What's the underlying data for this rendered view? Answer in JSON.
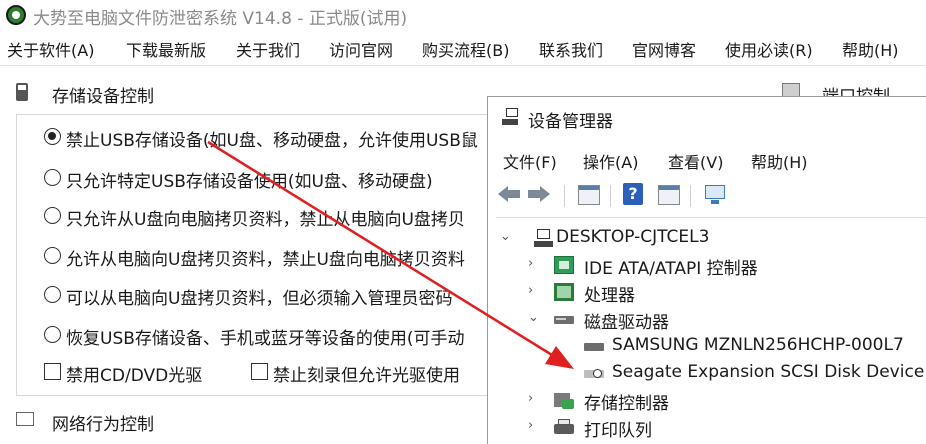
{
  "window": {
    "title": "大势至电脑文件防泄密系统 V14.8 - 正式版(试用)"
  },
  "menu": [
    "关于软件(A)",
    "下载最新版",
    "关于我们",
    "访问官网",
    "购买流程(B)",
    "联系我们",
    "官网博客",
    "使用必读(R)",
    "帮助(H)"
  ],
  "storage": {
    "title": "存储设备控制",
    "options": [
      {
        "label": "禁止USB存储设备(如U盘、移动硬盘，允许使用USB鼠",
        "checked": true
      },
      {
        "label": "只允许特定USB存储设备使用(如U盘、移动硬盘)",
        "checked": false
      },
      {
        "label": "只允许从U盘向电脑拷贝资料，禁止从电脑向U盘拷贝",
        "checked": false
      },
      {
        "label": "允许从电脑向U盘拷贝资料，禁止U盘向电脑拷贝资料",
        "checked": false
      },
      {
        "label": "可以从电脑向U盘拷贝资料，但必须输入管理员密码",
        "checked": false
      },
      {
        "label": "恢复USB存储设备、手机或蓝牙等设备的使用(可手动",
        "checked": false
      }
    ],
    "checkboxes": [
      {
        "label": "禁用CD/DVD光驱",
        "checked": false
      },
      {
        "label": "禁止刻录但允许光驱使用",
        "checked": false
      }
    ]
  },
  "port_title": "端口控制",
  "network_title": "网络行为控制",
  "device_manager": {
    "title": "设备管理器",
    "menu": [
      "文件(F)",
      "操作(A)",
      "查看(V)",
      "帮助(H)"
    ],
    "tree": {
      "root": "DESKTOP-CJTCEL3",
      "nodes": [
        {
          "label": "IDE ATA/ATAPI 控制器",
          "expanded": false
        },
        {
          "label": "处理器",
          "expanded": false
        },
        {
          "label": "磁盘驱动器",
          "expanded": true
        },
        {
          "label": "SAMSUNG MZNLN256HCHP-000L7",
          "child": true
        },
        {
          "label": "Seagate Expansion SCSI Disk Device",
          "child": true
        },
        {
          "label": "存储控制器",
          "expanded": false
        },
        {
          "label": "打印队列",
          "expanded": false
        }
      ]
    }
  },
  "icons": {
    "app": "app-logo-icon",
    "back": "back-arrow-icon",
    "forward": "forward-arrow-icon",
    "help": "help-icon",
    "scan": "monitor-scan-icon"
  },
  "colors": {
    "annotation_arrow": "#e02020",
    "help_icon": "#2c5fb8"
  }
}
